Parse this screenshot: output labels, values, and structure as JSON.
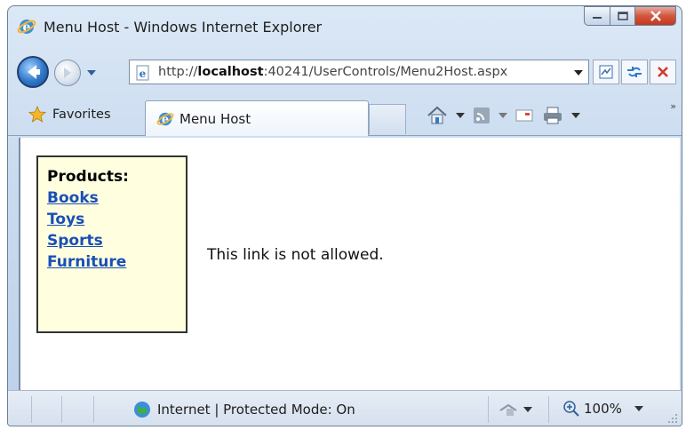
{
  "window": {
    "title": "Menu Host - Windows Internet Explorer"
  },
  "address": {
    "url_prefix": "http://",
    "url_host": "localhost",
    "url_rest": ":40241/UserControls/Menu2Host.aspx"
  },
  "tabs": {
    "favorites_label": "Favorites",
    "active_tab_label": "Menu Host"
  },
  "menu": {
    "heading": "Products:",
    "links": [
      "Books",
      "Toys",
      "Sports",
      "Furniture"
    ]
  },
  "message": "This link is not allowed.",
  "status": {
    "zone_text": "Internet | Protected Mode: On",
    "zoom_text": "100%"
  },
  "colors": {
    "link": "#1a4fb5",
    "menu_background": "#ffffe0"
  }
}
